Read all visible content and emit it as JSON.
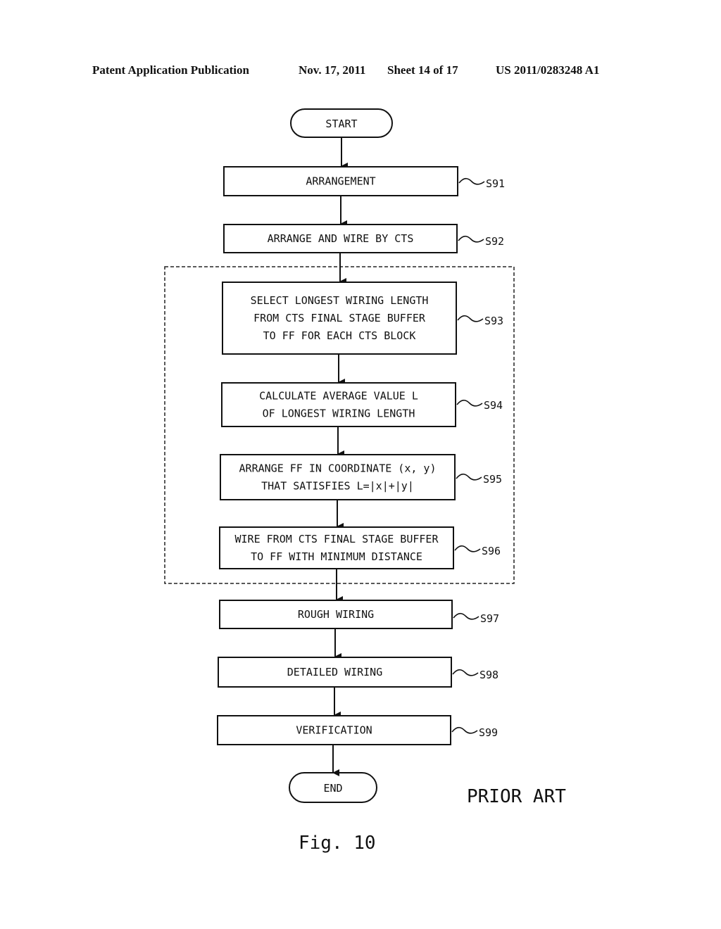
{
  "header": {
    "publication": "Patent Application Publication",
    "date": "Nov. 17, 2011",
    "sheet": "Sheet 14 of 17",
    "number": "US 2011/0283248 A1"
  },
  "flowchart": {
    "start": "START",
    "end": "END",
    "steps": [
      {
        "id": "S91",
        "lines": [
          "ARRANGEMENT"
        ]
      },
      {
        "id": "S92",
        "lines": [
          "ARRANGE AND WIRE BY CTS"
        ]
      },
      {
        "id": "S93",
        "lines": [
          "SELECT LONGEST WIRING LENGTH",
          "FROM CTS FINAL STAGE BUFFER",
          "TO FF FOR EACH CTS BLOCK"
        ]
      },
      {
        "id": "S94",
        "lines": [
          "CALCULATE AVERAGE VALUE L",
          "OF LONGEST WIRING LENGTH"
        ]
      },
      {
        "id": "S95",
        "lines": [
          "ARRANGE FF IN COORDINATE (x, y)",
          "THAT SATISFIES L=|x|+|y|"
        ]
      },
      {
        "id": "S96",
        "lines": [
          "WIRE FROM CTS FINAL STAGE BUFFER",
          "TO FF WITH MINIMUM DISTANCE"
        ]
      },
      {
        "id": "S97",
        "lines": [
          "ROUGH WIRING"
        ]
      },
      {
        "id": "S98",
        "lines": [
          "DETAILED WIRING"
        ]
      },
      {
        "id": "S99",
        "lines": [
          "VERIFICATION"
        ]
      }
    ]
  },
  "annotation": "PRIOR ART",
  "figure_label": "Fig. 10"
}
